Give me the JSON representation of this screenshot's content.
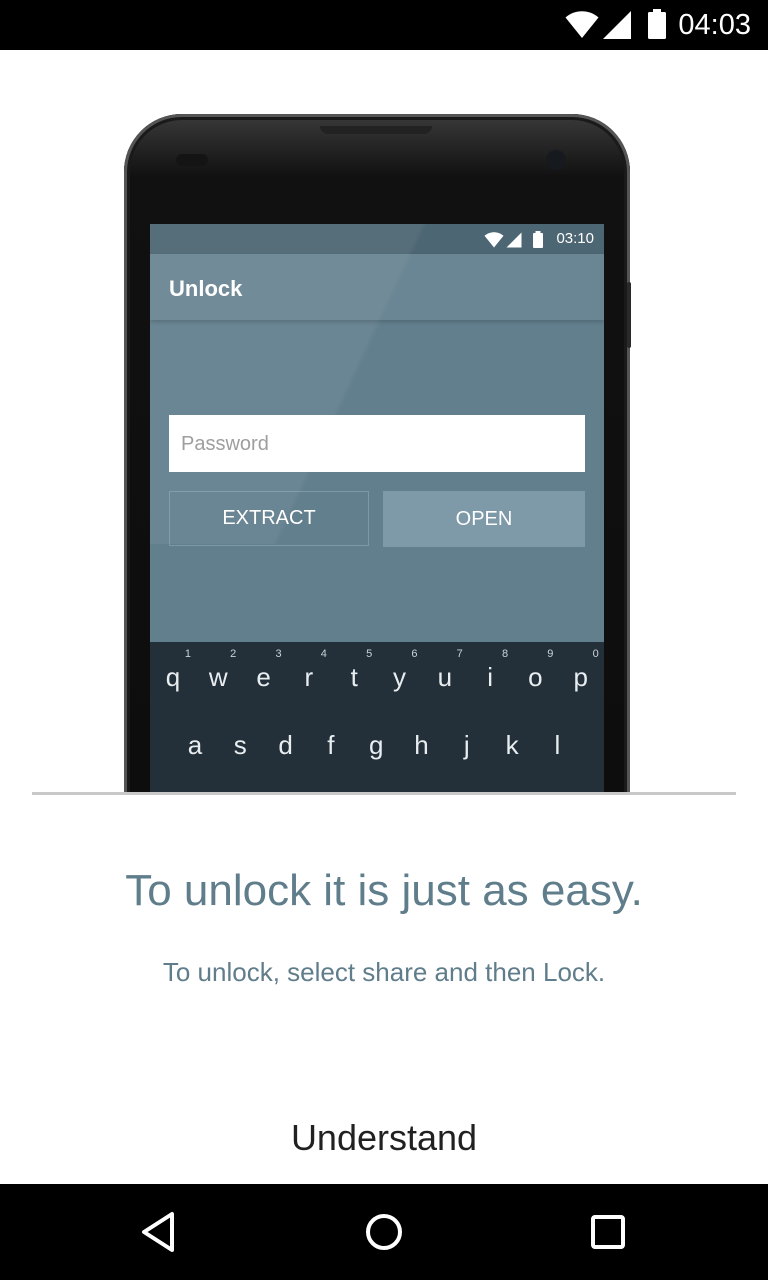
{
  "status_bar": {
    "time": "04:03",
    "icons": [
      "wifi-icon",
      "cellular-signal-icon",
      "battery-icon"
    ]
  },
  "illustration": {
    "status_time": "03:10",
    "app_title": "Unlock",
    "password_placeholder": "Password",
    "extract_label": "EXTRACT",
    "open_label": "OPEN",
    "keyboard": {
      "row1": [
        {
          "key": "q",
          "num": "1"
        },
        {
          "key": "w",
          "num": "2"
        },
        {
          "key": "e",
          "num": "3"
        },
        {
          "key": "r",
          "num": "4"
        },
        {
          "key": "t",
          "num": "5"
        },
        {
          "key": "y",
          "num": "6"
        },
        {
          "key": "u",
          "num": "7"
        },
        {
          "key": "i",
          "num": "8"
        },
        {
          "key": "o",
          "num": "9"
        },
        {
          "key": "p",
          "num": "0"
        }
      ],
      "row2": [
        "a",
        "s",
        "d",
        "f",
        "g",
        "h",
        "j",
        "k",
        "l"
      ]
    }
  },
  "content": {
    "headline": "To unlock it is just as easy.",
    "description": "To unlock, select share and then Lock.",
    "understand_label": "Understand"
  },
  "nav_bar": {
    "icons": [
      "back-icon",
      "home-icon",
      "recents-icon"
    ]
  },
  "colors": {
    "accent_text": "#607d8b",
    "screen_bg": "#627f8e",
    "keyboard_bg": "#23303a"
  }
}
